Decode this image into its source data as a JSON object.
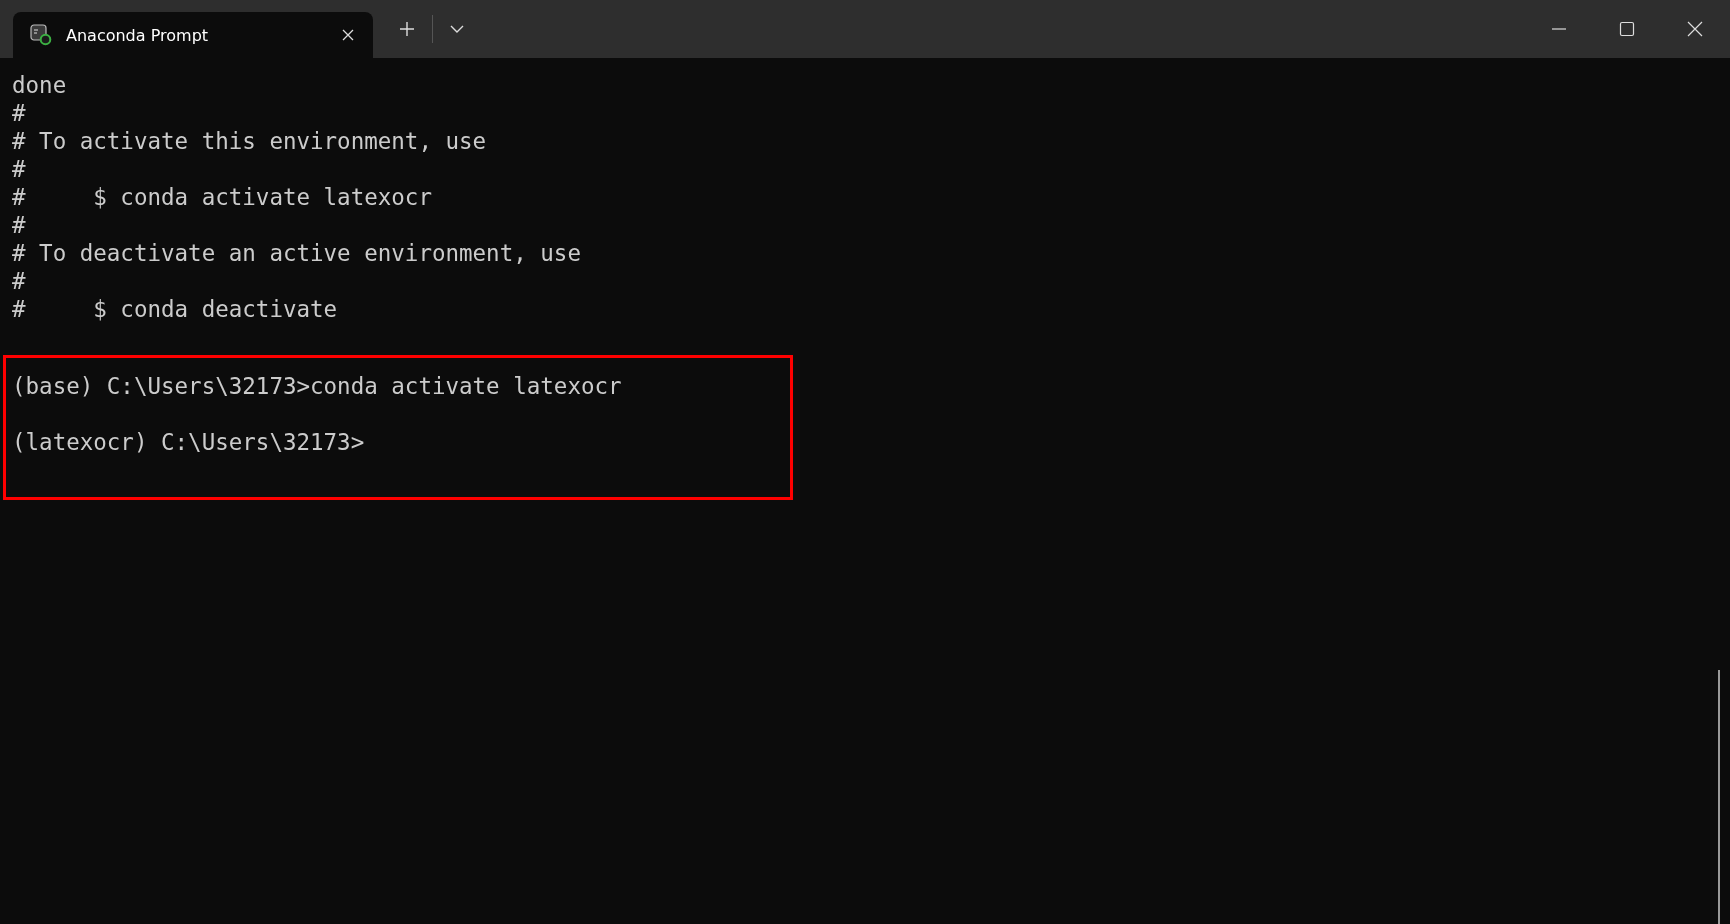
{
  "tabs": [
    {
      "title": "Anaconda Prompt",
      "selected": true
    }
  ],
  "terminal": {
    "lines": [
      {
        "kind": "text",
        "text": "done"
      },
      {
        "kind": "text",
        "text": "#"
      },
      {
        "kind": "text",
        "text": "# To activate this environment, use"
      },
      {
        "kind": "text",
        "text": "#"
      },
      {
        "kind": "text",
        "text": "#     $ conda activate latexocr"
      },
      {
        "kind": "text",
        "text": "#"
      },
      {
        "kind": "text",
        "text": "# To deactivate an active environment, use"
      },
      {
        "kind": "text",
        "text": "#"
      },
      {
        "kind": "text",
        "text": "#     $ conda deactivate"
      },
      {
        "kind": "blank"
      }
    ],
    "highlighted_lines": [
      {
        "kind": "text",
        "text": "(base) C:\\Users\\32173>conda activate latexocr"
      },
      {
        "kind": "blank"
      },
      {
        "kind": "text",
        "text": "(latexocr) C:\\Users\\32173>"
      },
      {
        "kind": "blank"
      }
    ]
  }
}
